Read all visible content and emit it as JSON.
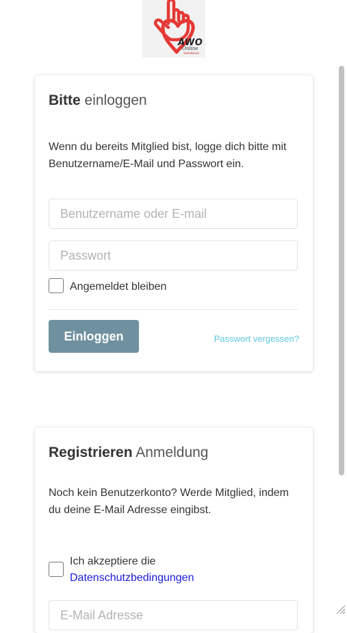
{
  "logo": {
    "text": "AWO",
    "subtext": "Online",
    "subtext2": "Sozialkasse"
  },
  "login": {
    "title_strong": "Bitte",
    "title_light": "einloggen",
    "description": "Wenn du bereits Mitglied bist, logge dich bitte mit Benutzername/E-Mail und Passwort ein.",
    "username_placeholder": "Benutzername oder E-mail",
    "password_placeholder": "Passwort",
    "remember_label": "Angemeldet bleiben",
    "remember_checked": false,
    "submit_label": "Einloggen",
    "forgot_label": "Passwort vergessen?"
  },
  "register": {
    "title_strong": "Registrieren",
    "title_light": "Anmeldung",
    "description": "Noch kein Benutzerkonto? Werde Mitglied, indem du deine E-Mail Adresse eingibst.",
    "accept_label": "Ich akzeptiere die",
    "privacy_link": "Datenschutzbedingungen",
    "accept_checked": false,
    "email_placeholder": "E-Mail Adresse"
  },
  "colors": {
    "button_bg": "#6f909f",
    "link_cyan": "#5bc6e0",
    "link_blue": "#1a1adb",
    "logo_red": "#e53935"
  }
}
